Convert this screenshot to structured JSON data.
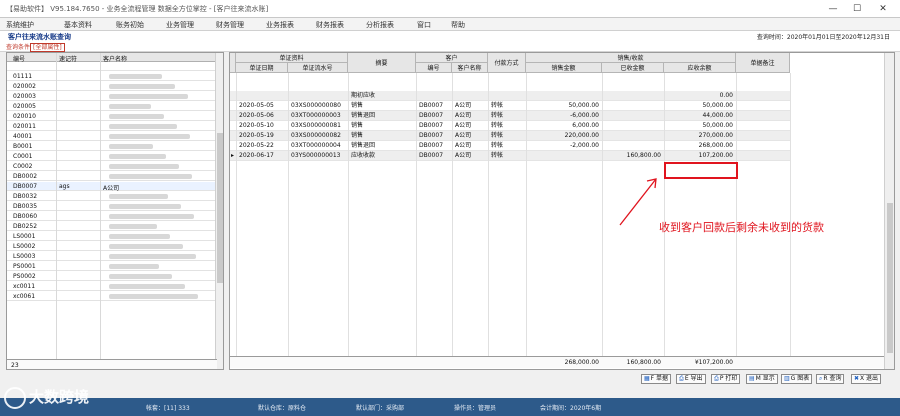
{
  "window": {
    "title": "【易助软件】 V95.184.7650 - 业务全流程管理 数据全方位掌控 - [客户往来流水账]",
    "min": "—",
    "max": "☐",
    "close": "✕"
  },
  "menu": [
    "系统维护",
    "基本资料",
    "账务初始",
    "业务管理",
    "财务管理",
    "业务报表",
    "财务报表",
    "分析报表",
    "窗口",
    "帮助"
  ],
  "page": {
    "title": "客户往来流水账查询",
    "period": "查询时间：2020年01月01日至2020年12月31日",
    "query_label": "查询条件",
    "query_value": "[全部属性]"
  },
  "left_table": {
    "headers": [
      "编号",
      "速记符",
      "客户名称"
    ],
    "rows": [
      {
        "code": "",
        "short": "",
        "name": ""
      },
      {
        "code": "01111",
        "short": "",
        "name": ""
      },
      {
        "code": "020002",
        "short": "",
        "name": ""
      },
      {
        "code": "020003",
        "short": "",
        "name": ""
      },
      {
        "code": "020005",
        "short": "",
        "name": ""
      },
      {
        "code": "020010",
        "short": "",
        "name": ""
      },
      {
        "code": "020011",
        "short": "",
        "name": ""
      },
      {
        "code": "40001",
        "short": "",
        "name": ""
      },
      {
        "code": "B0001",
        "short": "",
        "name": ""
      },
      {
        "code": "C0001",
        "short": "",
        "name": ""
      },
      {
        "code": "C0002",
        "short": "",
        "name": ""
      },
      {
        "code": "DB0002",
        "short": "",
        "name": ""
      },
      {
        "code": "DB0007",
        "short": "ags",
        "name": "A公司"
      },
      {
        "code": "DB0032",
        "short": "",
        "name": ""
      },
      {
        "code": "DB0035",
        "short": "",
        "name": ""
      },
      {
        "code": "DB0060",
        "short": "",
        "name": ""
      },
      {
        "code": "DB0252",
        "short": "",
        "name": ""
      },
      {
        "code": "LS0001",
        "short": "",
        "name": ""
      },
      {
        "code": "LS0002",
        "short": "",
        "name": ""
      },
      {
        "code": "LS0003",
        "short": "",
        "name": ""
      },
      {
        "code": "PS0001",
        "short": "",
        "name": ""
      },
      {
        "code": "PS0002",
        "short": "",
        "name": ""
      },
      {
        "code": "xc0011",
        "short": "",
        "name": ""
      },
      {
        "code": "xc0061",
        "short": "",
        "name": ""
      }
    ],
    "footer_count": "23"
  },
  "right_table": {
    "group_headers": {
      "voucher": "单证资料",
      "customer": "客户",
      "sales": "销售/收款"
    },
    "headers": {
      "date": "单证日期",
      "serial": "单证流水号",
      "summary": "摘要",
      "cust_code": "编号",
      "cust_name": "客户名称",
      "payment": "付款方式",
      "sales_amount": "销售金额",
      "received": "已收金额",
      "receivable": "应收余额",
      "remark": "单据备注"
    },
    "rows": [
      {
        "date": "",
        "serial": "",
        "summary": "期初应收",
        "cust_code": "",
        "cust_name": "",
        "payment": "",
        "sales_amount": "",
        "received": "",
        "receivable": "0.00"
      },
      {
        "date": "2020-05-05",
        "serial": "03XS000000080",
        "summary": "销售",
        "cust_code": "DB0007",
        "cust_name": "A公司",
        "payment": "转帐",
        "sales_amount": "50,000.00",
        "received": "",
        "receivable": "50,000.00"
      },
      {
        "date": "2020-05-06",
        "serial": "03XT000000003",
        "summary": "销售退回",
        "cust_code": "DB0007",
        "cust_name": "A公司",
        "payment": "转帐",
        "sales_amount": "-6,000.00",
        "received": "",
        "receivable": "44,000.00"
      },
      {
        "date": "2020-05-10",
        "serial": "03XS000000081",
        "summary": "销售",
        "cust_code": "DB0007",
        "cust_name": "A公司",
        "payment": "转帐",
        "sales_amount": "6,000.00",
        "received": "",
        "receivable": "50,000.00"
      },
      {
        "date": "2020-05-19",
        "serial": "03XS000000082",
        "summary": "销售",
        "cust_code": "DB0007",
        "cust_name": "A公司",
        "payment": "转帐",
        "sales_amount": "220,000.00",
        "received": "",
        "receivable": "270,000.00"
      },
      {
        "date": "2020-05-22",
        "serial": "03XT000000004",
        "summary": "销售退回",
        "cust_code": "DB0007",
        "cust_name": "A公司",
        "payment": "转帐",
        "sales_amount": "-2,000.00",
        "received": "",
        "receivable": "268,000.00"
      },
      {
        "date": "2020-06-17",
        "serial": "03YS000000013",
        "summary": "应收收款",
        "cust_code": "DB0007",
        "cust_name": "A公司",
        "payment": "转帐",
        "sales_amount": "",
        "received": "160,800.00",
        "receivable": "107,200.00"
      }
    ],
    "totals": {
      "sales_amount": "268,000.00",
      "received": "160,800.00",
      "receivable": "¥107,200.00"
    }
  },
  "annotation": "收到客户回款后剩余未收到的货款",
  "toolbar": [
    {
      "icon": "▦",
      "label": "F 单据"
    },
    {
      "icon": "⎙",
      "label": "E 导出"
    },
    {
      "icon": "⎙",
      "label": "P 打印"
    },
    {
      "icon": "▤",
      "label": "M 显示"
    },
    {
      "icon": "▥",
      "label": "G 图表"
    },
    {
      "icon": "⌕",
      "label": "R 查询"
    },
    {
      "icon": "✖",
      "label": "X 退出"
    }
  ],
  "statusbar": {
    "account": "帐套：[11] 333",
    "warehouse": "默认仓库：原料仓",
    "department": "默认部门：采购部",
    "operator": "操作员：管理员",
    "accounting_period": "会计期间：2020年6期"
  },
  "watermark": "大数跨境",
  "colors": {
    "accent_red": "#e0141e",
    "title_blue": "#1a3d8a",
    "status_bg": "#2d5a8a"
  }
}
